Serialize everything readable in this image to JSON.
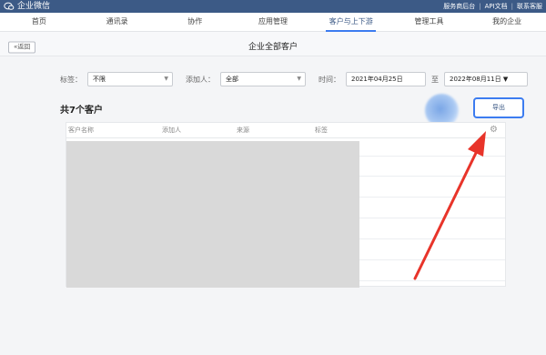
{
  "app": {
    "title": "企业微信",
    "top_links": [
      "服务商后台",
      "API文档",
      "联系客服"
    ]
  },
  "nav": {
    "items": [
      {
        "label": "首页",
        "active": false
      },
      {
        "label": "通讯录",
        "active": false
      },
      {
        "label": "协作",
        "active": false
      },
      {
        "label": "应用管理",
        "active": false
      },
      {
        "label": "客户与上下游",
        "active": true
      },
      {
        "label": "管理工具",
        "active": false
      },
      {
        "label": "我的企业",
        "active": false
      }
    ]
  },
  "header": {
    "back_label": "返回",
    "title": "企业全部客户"
  },
  "filters": {
    "tag_label": "标签：",
    "tag_value": "不限",
    "adder_label": "添加人：",
    "adder_value": "全部",
    "time_label": "时间：",
    "start_date": "2021年04月25日",
    "range_sep": "至",
    "end_date": "2022年08月11日"
  },
  "summary": "共7个客户",
  "export_label": "导出",
  "table": {
    "columns": [
      "客户名称",
      "添加人",
      "来源",
      "标签"
    ],
    "row_count": 7
  },
  "colors": {
    "topbar": "#3c5a86",
    "accent": "#3c7cf0",
    "annotation_arrow": "#e8342a"
  },
  "icons": [
    "wecom-logo-icon",
    "chevron-down-icon",
    "settings-gear-icon",
    "arrow-annotation"
  ]
}
